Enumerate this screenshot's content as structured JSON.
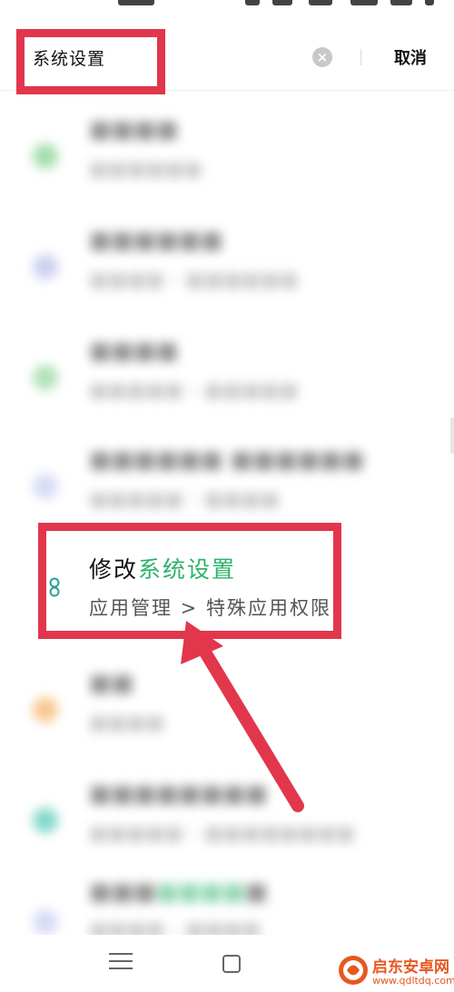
{
  "search": {
    "query": "系统设置",
    "cancel_label": "取消",
    "clear_icon": "close-circle-icon"
  },
  "focused_result": {
    "title_prefix": "修改",
    "title_highlight": "系统设置",
    "path": "应用管理 > 特殊应用权限",
    "icon": "link-icon"
  },
  "colors": {
    "highlight": "#2bb36a",
    "annotation": "#e2364d",
    "watermark": "#e8571e"
  },
  "navigation": {
    "menu_icon": "menu-icon",
    "home_icon": "home-icon"
  },
  "watermark": {
    "title": "启东安卓网",
    "url": "www.qdltdq.com"
  }
}
